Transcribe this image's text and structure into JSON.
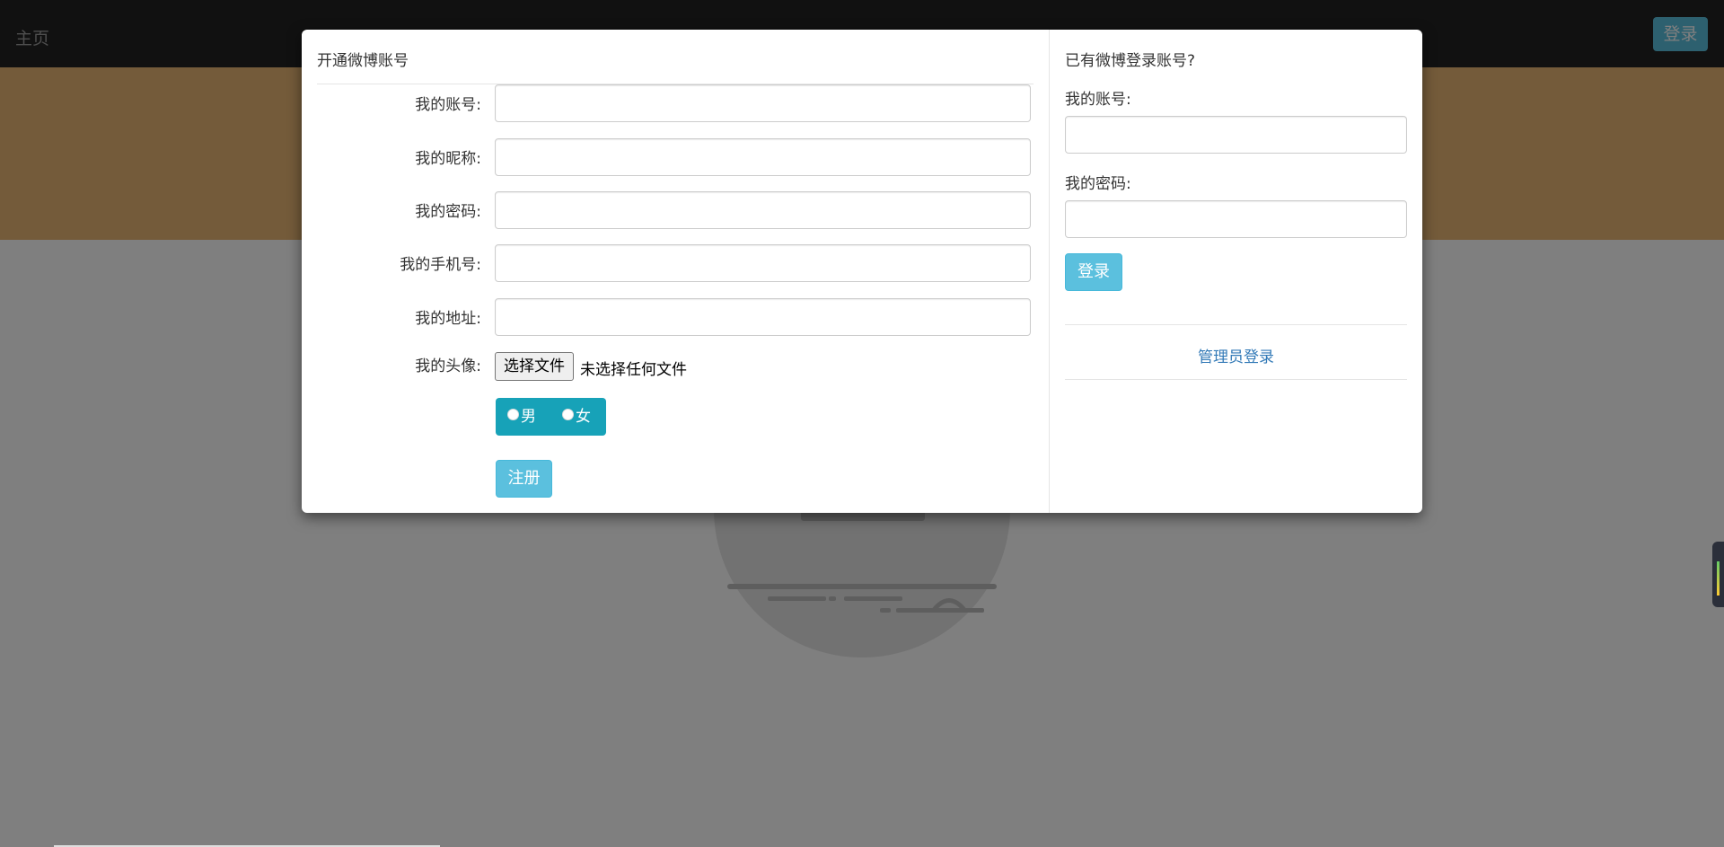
{
  "navbar": {
    "brand": "主页",
    "login_button": "登录"
  },
  "register": {
    "title": "开通微博账号",
    "fields": [
      {
        "label": "我的账号:",
        "value": ""
      },
      {
        "label": "我的昵称:",
        "value": ""
      },
      {
        "label": "我的密码:",
        "value": ""
      },
      {
        "label": "我的手机号:",
        "value": ""
      },
      {
        "label": "我的地址:",
        "value": ""
      }
    ],
    "avatar": {
      "label": "我的头像:",
      "button": "选择文件",
      "status": "未选择任何文件"
    },
    "gender": {
      "options": [
        "男",
        "女"
      ],
      "selected": null
    },
    "submit": "注册"
  },
  "login": {
    "title": "已有微博登录账号?",
    "account_label": "我的账号:",
    "account_value": "",
    "password_label": "我的密码:",
    "password_value": "",
    "submit": "登录",
    "admin_link": "管理员登录"
  },
  "colors": {
    "navbar": "#222222",
    "banner": "#e9b774",
    "info_button": "#5bc0de",
    "radio_group": "#17a2b8",
    "link": "#337ab7"
  }
}
